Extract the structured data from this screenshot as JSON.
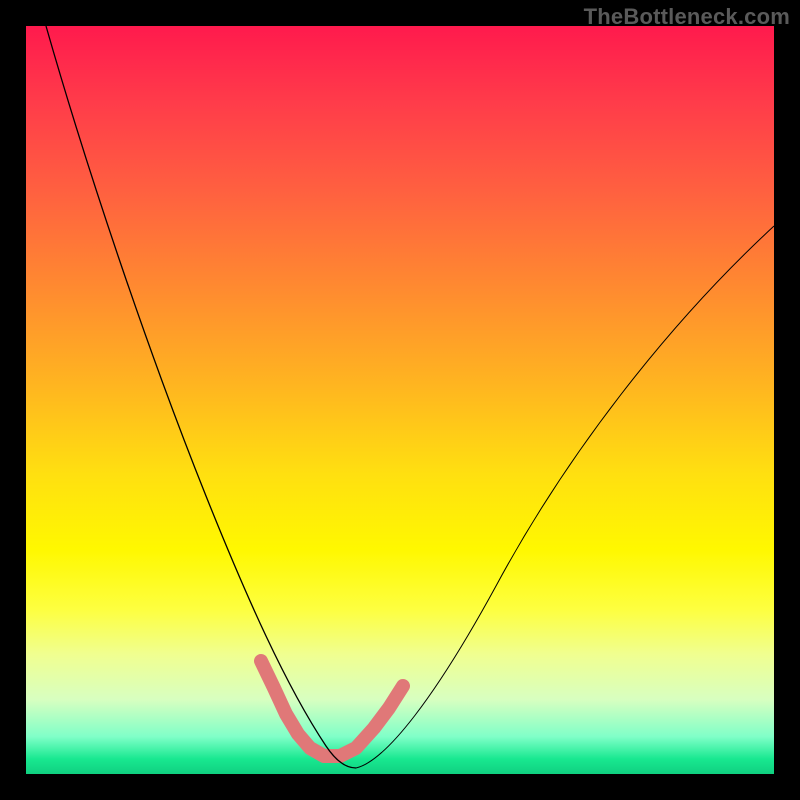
{
  "watermark": "TheBottleneck.com",
  "colors": {
    "gradient_top": "#ff1a4d",
    "gradient_bottom": "#10d080",
    "curve": "#000000",
    "marker": "#e07878",
    "frame": "#000000"
  },
  "chart_data": {
    "type": "line",
    "title": "",
    "xlabel": "",
    "ylabel": "",
    "xlim": [
      0,
      100
    ],
    "ylim": [
      0,
      100
    ],
    "grid": false,
    "legend": false,
    "annotations": [
      "TheBottleneck.com"
    ],
    "series": [
      {
        "name": "bottleneck-curve",
        "x": [
          2,
          6,
          10,
          14,
          18,
          22,
          25,
          28,
          31,
          33,
          35,
          37,
          39,
          41,
          43,
          46,
          50,
          55,
          60,
          66,
          73,
          80,
          88,
          96,
          100
        ],
        "y": [
          100,
          87,
          74,
          62,
          51,
          41,
          34,
          27,
          20,
          15,
          11,
          7,
          4,
          2,
          2,
          3,
          7,
          13,
          21,
          30,
          40,
          51,
          62,
          72,
          77
        ]
      }
    ],
    "highlighted_region": {
      "name": "near-minimum-band",
      "x": [
        33,
        35,
        37,
        39,
        41,
        43,
        46,
        49
      ],
      "y": [
        15,
        11,
        7,
        4,
        2,
        2,
        4,
        8
      ]
    },
    "minimum": {
      "x": 42,
      "y": 2
    }
  }
}
